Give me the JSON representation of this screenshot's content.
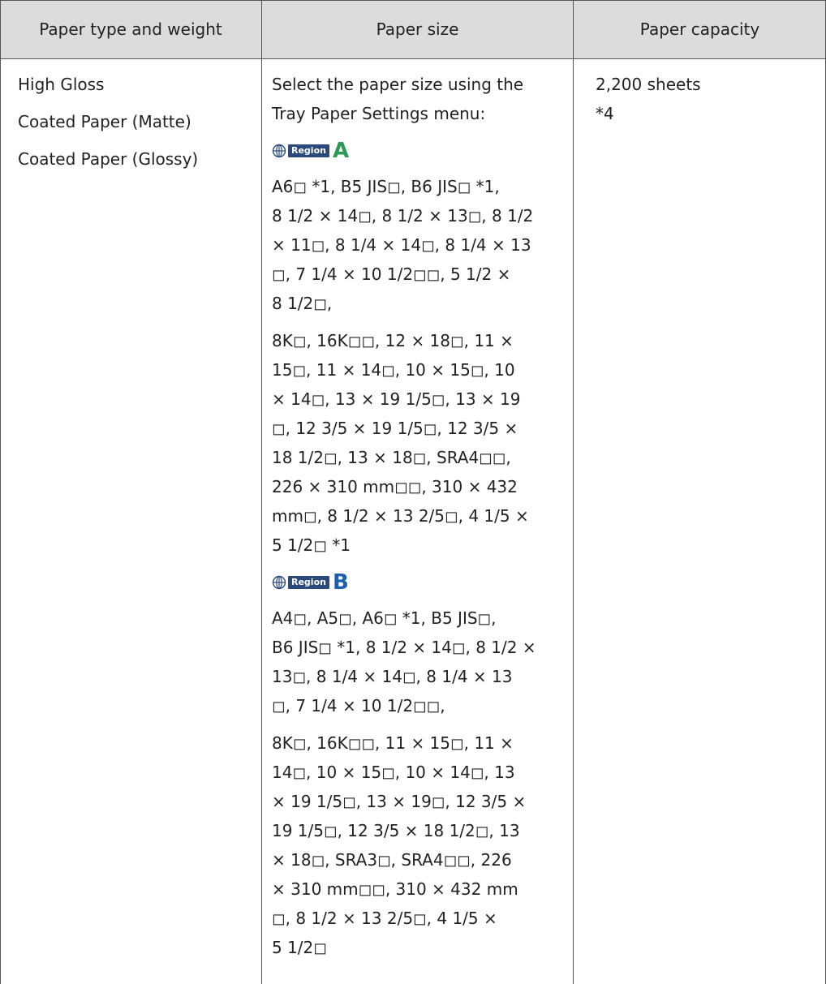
{
  "headers": [
    "Paper type and weight",
    "Paper size",
    "Paper capacity"
  ],
  "paper_types": [
    "High Gloss",
    "Coated Paper (Matte)",
    "Coated Paper (Glossy)"
  ],
  "intro": [
    "Select the paper size using the",
    "Tray Paper Settings menu:"
  ],
  "region_label": "Region",
  "region_a_letter": "A",
  "region_b_letter": "B",
  "region_a_group1": [
    "A6◻ *1, B5 JIS◻, B6 JIS◻ *1,",
    "8 1/2 × 14◻, 8 1/2 × 13◻, 8 1/2",
    "× 11◻, 8 1/4 × 14◻, 8 1/4 × 13",
    "◻, 7 1/4 × 10 1/2◻◻, 5 1/2 ×",
    "8 1/2◻,"
  ],
  "region_a_group2": [
    "8K◻, 16K◻◻, 12 × 18◻, 11 ×",
    "15◻, 11 × 14◻, 10 × 15◻, 10",
    "× 14◻, 13 × 19 1/5◻, 13 × 19",
    "◻, 12 3/5 × 19 1/5◻, 12 3/5 ×",
    "18 1/2◻, 13 × 18◻, SRA4◻◻,",
    "226 × 310 mm◻◻, 310 × 432",
    "mm◻, 8 1/2 × 13 2/5◻, 4 1/5 ×",
    "5 1/2◻ *1"
  ],
  "region_b_group1": [
    "A4◻, A5◻, A6◻ *1, B5 JIS◻,",
    "B6 JIS◻ *1, 8 1/2 × 14◻, 8 1/2 ×",
    "13◻, 8 1/4 × 14◻, 8 1/4 × 13",
    "◻, 7 1/4 × 10 1/2◻◻,"
  ],
  "region_b_group2": [
    "8K◻, 16K◻◻, 11 × 15◻, 11 ×",
    "14◻, 10 × 15◻, 10 × 14◻, 13",
    "× 19 1/5◻, 13 × 19◻, 12 3/5 ×",
    "19 1/5◻, 12 3/5 × 18 1/2◻, 13",
    "× 18◻, SRA3◻, SRA4◻◻, 226",
    "× 310 mm◻◻, 310 × 432 mm",
    "◻, 8 1/2 × 13 2/5◻, 4 1/5 ×",
    "5 1/2◻"
  ],
  "capacity": "2,200 sheets",
  "capacity_note": "*4"
}
